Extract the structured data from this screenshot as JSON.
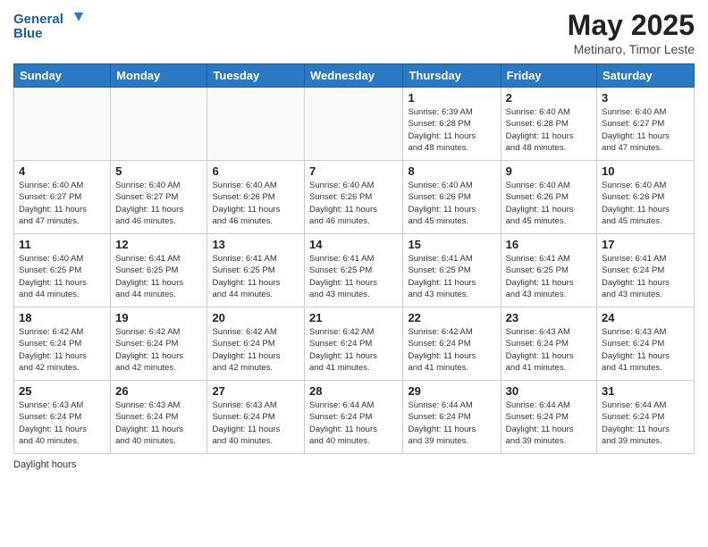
{
  "logo": {
    "line1": "General",
    "line2": "Blue"
  },
  "title": "May 2025",
  "subtitle": "Metinaro, Timor Leste",
  "days_of_week": [
    "Sunday",
    "Monday",
    "Tuesday",
    "Wednesday",
    "Thursday",
    "Friday",
    "Saturday"
  ],
  "weeks": [
    [
      {
        "day": "",
        "info": ""
      },
      {
        "day": "",
        "info": ""
      },
      {
        "day": "",
        "info": ""
      },
      {
        "day": "",
        "info": ""
      },
      {
        "day": "1",
        "info": "Sunrise: 6:39 AM\nSunset: 6:28 PM\nDaylight: 11 hours\nand 48 minutes."
      },
      {
        "day": "2",
        "info": "Sunrise: 6:40 AM\nSunset: 6:28 PM\nDaylight: 11 hours\nand 48 minutes."
      },
      {
        "day": "3",
        "info": "Sunrise: 6:40 AM\nSunset: 6:27 PM\nDaylight: 11 hours\nand 47 minutes."
      }
    ],
    [
      {
        "day": "4",
        "info": "Sunrise: 6:40 AM\nSunset: 6:27 PM\nDaylight: 11 hours\nand 47 minutes."
      },
      {
        "day": "5",
        "info": "Sunrise: 6:40 AM\nSunset: 6:27 PM\nDaylight: 11 hours\nand 46 minutes."
      },
      {
        "day": "6",
        "info": "Sunrise: 6:40 AM\nSunset: 6:26 PM\nDaylight: 11 hours\nand 46 minutes."
      },
      {
        "day": "7",
        "info": "Sunrise: 6:40 AM\nSunset: 6:26 PM\nDaylight: 11 hours\nand 46 minutes."
      },
      {
        "day": "8",
        "info": "Sunrise: 6:40 AM\nSunset: 6:26 PM\nDaylight: 11 hours\nand 45 minutes."
      },
      {
        "day": "9",
        "info": "Sunrise: 6:40 AM\nSunset: 6:26 PM\nDaylight: 11 hours\nand 45 minutes."
      },
      {
        "day": "10",
        "info": "Sunrise: 6:40 AM\nSunset: 6:26 PM\nDaylight: 11 hours\nand 45 minutes."
      }
    ],
    [
      {
        "day": "11",
        "info": "Sunrise: 6:40 AM\nSunset: 6:25 PM\nDaylight: 11 hours\nand 44 minutes."
      },
      {
        "day": "12",
        "info": "Sunrise: 6:41 AM\nSunset: 6:25 PM\nDaylight: 11 hours\nand 44 minutes."
      },
      {
        "day": "13",
        "info": "Sunrise: 6:41 AM\nSunset: 6:25 PM\nDaylight: 11 hours\nand 44 minutes."
      },
      {
        "day": "14",
        "info": "Sunrise: 6:41 AM\nSunset: 6:25 PM\nDaylight: 11 hours\nand 43 minutes."
      },
      {
        "day": "15",
        "info": "Sunrise: 6:41 AM\nSunset: 6:25 PM\nDaylight: 11 hours\nand 43 minutes."
      },
      {
        "day": "16",
        "info": "Sunrise: 6:41 AM\nSunset: 6:25 PM\nDaylight: 11 hours\nand 43 minutes."
      },
      {
        "day": "17",
        "info": "Sunrise: 6:41 AM\nSunset: 6:24 PM\nDaylight: 11 hours\nand 43 minutes."
      }
    ],
    [
      {
        "day": "18",
        "info": "Sunrise: 6:42 AM\nSunset: 6:24 PM\nDaylight: 11 hours\nand 42 minutes."
      },
      {
        "day": "19",
        "info": "Sunrise: 6:42 AM\nSunset: 6:24 PM\nDaylight: 11 hours\nand 42 minutes."
      },
      {
        "day": "20",
        "info": "Sunrise: 6:42 AM\nSunset: 6:24 PM\nDaylight: 11 hours\nand 42 minutes."
      },
      {
        "day": "21",
        "info": "Sunrise: 6:42 AM\nSunset: 6:24 PM\nDaylight: 11 hours\nand 41 minutes."
      },
      {
        "day": "22",
        "info": "Sunrise: 6:42 AM\nSunset: 6:24 PM\nDaylight: 11 hours\nand 41 minutes."
      },
      {
        "day": "23",
        "info": "Sunrise: 6:43 AM\nSunset: 6:24 PM\nDaylight: 11 hours\nand 41 minutes."
      },
      {
        "day": "24",
        "info": "Sunrise: 6:43 AM\nSunset: 6:24 PM\nDaylight: 11 hours\nand 41 minutes."
      }
    ],
    [
      {
        "day": "25",
        "info": "Sunrise: 6:43 AM\nSunset: 6:24 PM\nDaylight: 11 hours\nand 40 minutes."
      },
      {
        "day": "26",
        "info": "Sunrise: 6:43 AM\nSunset: 6:24 PM\nDaylight: 11 hours\nand 40 minutes."
      },
      {
        "day": "27",
        "info": "Sunrise: 6:43 AM\nSunset: 6:24 PM\nDaylight: 11 hours\nand 40 minutes."
      },
      {
        "day": "28",
        "info": "Sunrise: 6:44 AM\nSunset: 6:24 PM\nDaylight: 11 hours\nand 40 minutes."
      },
      {
        "day": "29",
        "info": "Sunrise: 6:44 AM\nSunset: 6:24 PM\nDaylight: 11 hours\nand 39 minutes."
      },
      {
        "day": "30",
        "info": "Sunrise: 6:44 AM\nSunset: 6:24 PM\nDaylight: 11 hours\nand 39 minutes."
      },
      {
        "day": "31",
        "info": "Sunrise: 6:44 AM\nSunset: 6:24 PM\nDaylight: 11 hours\nand 39 minutes."
      }
    ]
  ],
  "footer_text": "Daylight hours"
}
